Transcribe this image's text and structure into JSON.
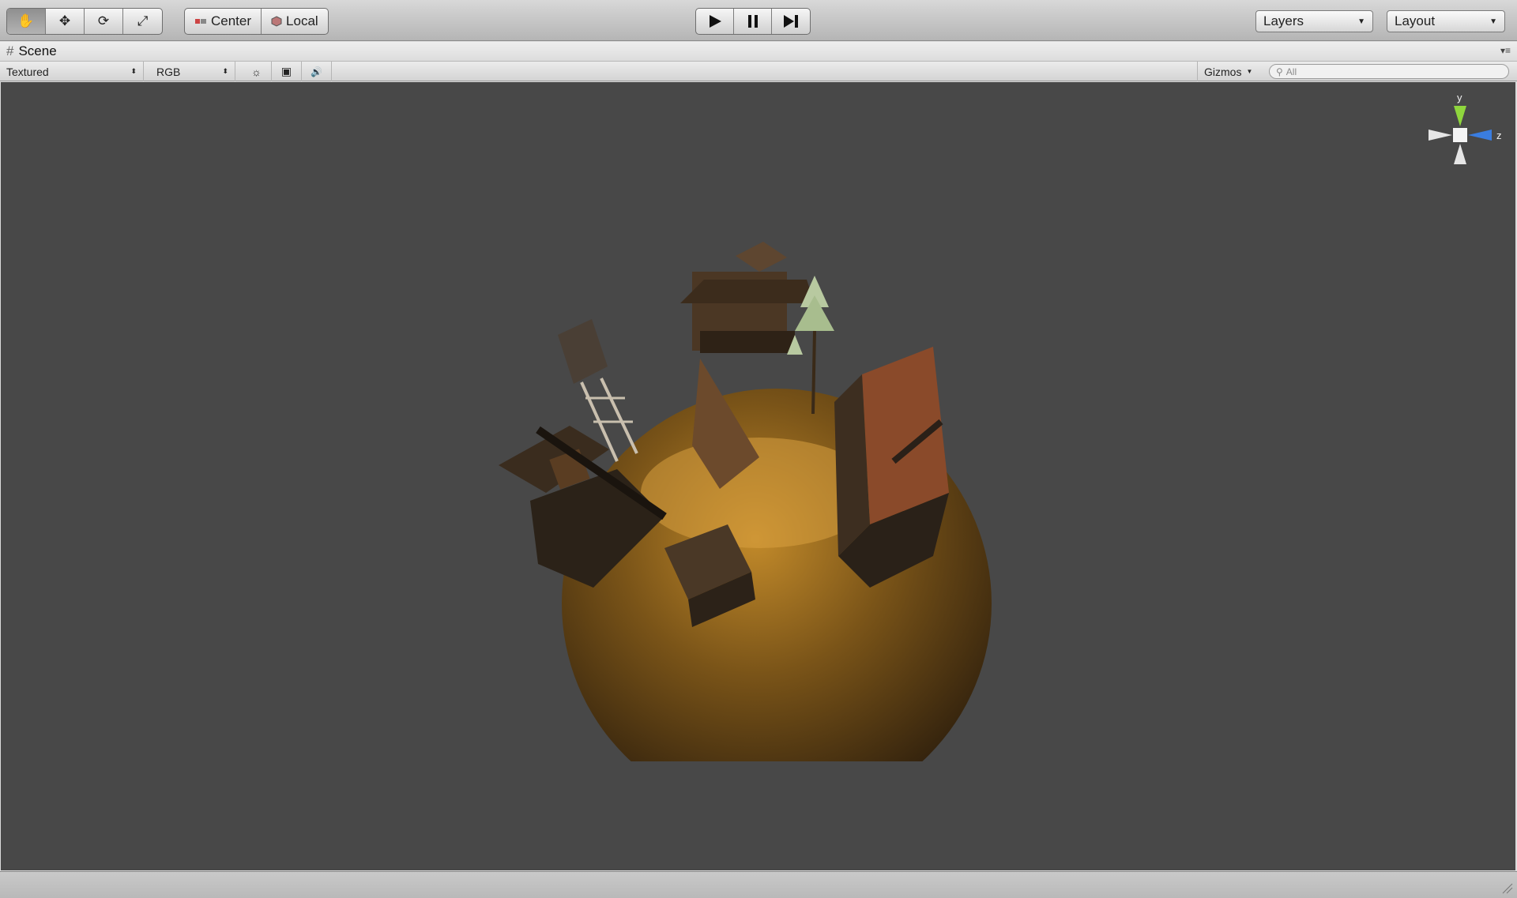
{
  "toolbar": {
    "tools": [
      {
        "name": "hand-tool-icon",
        "glyph": "✋",
        "active": true
      },
      {
        "name": "move-tool-icon",
        "glyph": "✥",
        "active": false
      },
      {
        "name": "rotate-tool-icon",
        "glyph": "⟳",
        "active": false
      },
      {
        "name": "scale-tool-icon",
        "glyph": "⤢",
        "active": false
      }
    ],
    "pivot": {
      "center_label": "Center",
      "local_label": "Local"
    },
    "playback": {
      "play_icon": "▶",
      "pause_icon": "❚❚",
      "step_icon": "▶❙"
    },
    "layers_label": "Layers",
    "layout_label": "Layout"
  },
  "scene_tab": {
    "icon": "#",
    "label": "Scene",
    "menu_icon": "▾≡"
  },
  "controls": {
    "render_mode": "Textured",
    "color_mode": "RGB",
    "lighting_icon": "☼",
    "image_icon": "▣",
    "audio_icon": "🔊",
    "gizmos_label": "Gizmos",
    "search_placeholder": "All"
  },
  "axis_gizmo": {
    "y_label": "y",
    "z_label": "z"
  },
  "colors": {
    "viewport_bg": "#484848",
    "y_axis": "#8fd63d",
    "z_axis": "#3a7de0",
    "planet_light": "#c28a2a",
    "planet_dark": "#2a1c0c"
  }
}
